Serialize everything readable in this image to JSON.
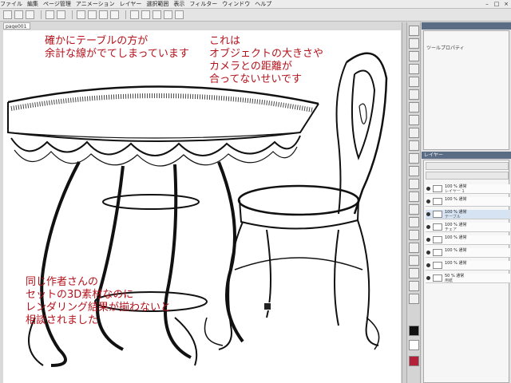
{
  "menu": {
    "items": [
      "ファイル",
      "編集",
      "ページ管理",
      "アニメーション",
      "レイヤー",
      "選択範囲",
      "表示",
      "フィルター",
      "ウィンドウ",
      "ヘルプ"
    ]
  },
  "document": {
    "tab_label": "page001"
  },
  "annotations": {
    "top_left": [
      "確かにテーブルの方が",
      "余計な線がでてしまっています"
    ],
    "top_right": [
      "これは",
      "オブジェクトの大きさや",
      "カメラとの距離が",
      "合ってないせいです"
    ],
    "bottom_left": [
      "同じ作者さんの",
      "セットの3D素材なのに",
      "レンダリング結果が揃わないと",
      "相談されました"
    ]
  },
  "panels": {
    "property": {
      "title": "",
      "label": "ツールプロパティ"
    },
    "layer": {
      "title": "レイヤー"
    }
  },
  "layers": [
    {
      "name": "100 % 通常",
      "sub": "レイヤー 1"
    },
    {
      "name": "100 % 通常",
      "sub": ""
    },
    {
      "name": "100 % 通常",
      "sub": "テーブル"
    },
    {
      "name": "100 % 通常",
      "sub": "チェア"
    },
    {
      "name": "100 % 通常",
      "sub": ""
    },
    {
      "name": "100 % 通常",
      "sub": ""
    },
    {
      "name": "100 % 通常",
      "sub": ""
    },
    {
      "name": "50 % 通常",
      "sub": "用紙"
    }
  ],
  "colors": {
    "annotation": "#b4121b",
    "panel_title": "#5b6d85"
  }
}
